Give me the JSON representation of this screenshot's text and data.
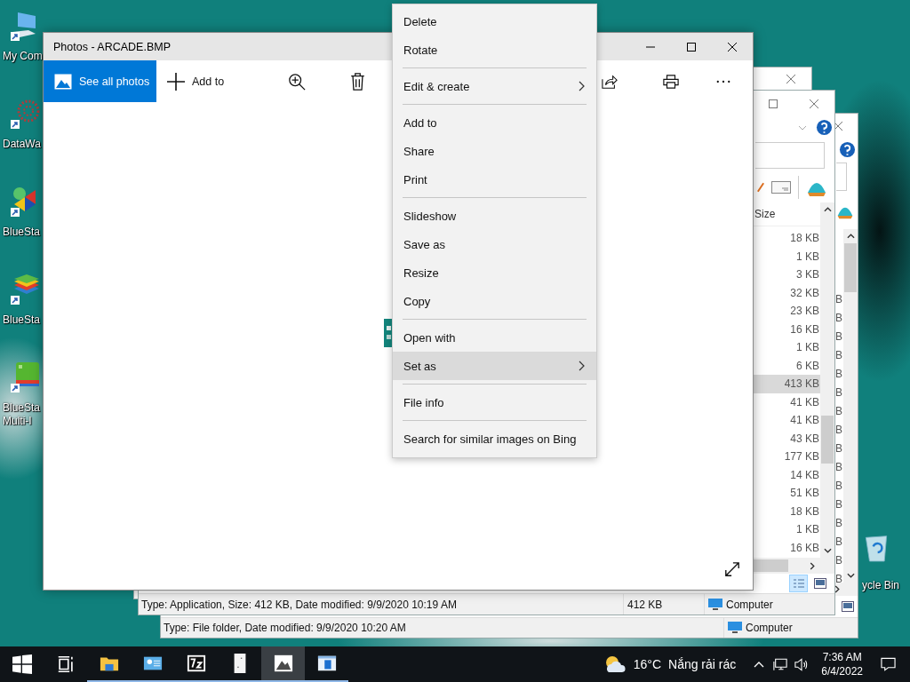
{
  "desktop": {
    "icons": [
      {
        "kind": "computer",
        "lines": [
          "My Com"
        ]
      },
      {
        "kind": "datawag",
        "lines": [
          "DataWa"
        ]
      },
      {
        "kind": "bluestacks-x",
        "lines": [
          "BlueSta"
        ]
      },
      {
        "kind": "bluestacks",
        "lines": [
          "BlueSta"
        ]
      },
      {
        "kind": "multi",
        "lines": [
          "BlueSta",
          "Multi-I"
        ]
      }
    ],
    "recycle_bin": {
      "label": "ycle Bin"
    }
  },
  "explorer_back": {
    "rows": [
      "B",
      "B",
      "B",
      "B",
      "B",
      "B",
      "B",
      "B",
      "B",
      "B",
      "B",
      "B",
      "B",
      "B",
      "B",
      "B"
    ],
    "status": {
      "info": "Type: File folder, Date modified: 9/9/2020 10:20 AM",
      "location": "Computer"
    }
  },
  "explorer_middle": {
    "size_header": "Size",
    "rows": [
      {
        "size": "18 KB",
        "selected": false
      },
      {
        "size": "1 KB",
        "selected": false
      },
      {
        "size": "3 KB",
        "selected": false
      },
      {
        "size": "32 KB",
        "selected": false
      },
      {
        "size": "23 KB",
        "selected": false
      },
      {
        "size": "16 KB",
        "selected": false
      },
      {
        "size": "1 KB",
        "selected": false
      },
      {
        "size": "6 KB",
        "selected": false
      },
      {
        "size": "413 KB",
        "selected": true
      },
      {
        "size": "41 KB",
        "selected": false
      },
      {
        "size": "41 KB",
        "selected": false
      },
      {
        "size": "43 KB",
        "selected": false
      },
      {
        "size": "177 KB",
        "selected": false
      },
      {
        "size": "14 KB",
        "selected": false
      },
      {
        "size": "51 KB",
        "selected": false
      },
      {
        "size": "18 KB",
        "selected": false
      },
      {
        "size": "1 KB",
        "selected": false
      },
      {
        "size": "16 KB",
        "selected": false
      }
    ],
    "status": {
      "info": "Type: Application, Size: 412 KB, Date modified: 9/9/2020 10:19 AM",
      "size": "412 KB",
      "location": "Computer"
    }
  },
  "photos": {
    "title": "Photos - ARCADE.BMP",
    "see_all": "See all photos",
    "add_to": "Add to"
  },
  "context_menu": {
    "groups": [
      [
        {
          "label": "Delete",
          "submenu": false,
          "selected": false
        },
        {
          "label": "Rotate",
          "submenu": false,
          "selected": false
        }
      ],
      [
        {
          "label": "Edit & create",
          "submenu": true,
          "selected": false
        }
      ],
      [
        {
          "label": "Add to",
          "submenu": false,
          "selected": false
        },
        {
          "label": "Share",
          "submenu": false,
          "selected": false
        },
        {
          "label": "Print",
          "submenu": false,
          "selected": false
        }
      ],
      [
        {
          "label": "Slideshow",
          "submenu": false,
          "selected": false
        },
        {
          "label": "Save as",
          "submenu": false,
          "selected": false
        },
        {
          "label": "Resize",
          "submenu": false,
          "selected": false
        },
        {
          "label": "Copy",
          "submenu": false,
          "selected": false
        }
      ],
      [
        {
          "label": "Open with",
          "submenu": false,
          "selected": false
        },
        {
          "label": "Set as",
          "submenu": true,
          "selected": true
        }
      ],
      [
        {
          "label": "File info",
          "submenu": false,
          "selected": false
        }
      ],
      [
        {
          "label": "Search for similar images on Bing",
          "submenu": false,
          "selected": false
        }
      ]
    ]
  },
  "taskbar": {
    "apps": [
      {
        "kind": "explorer",
        "open": true,
        "active": false
      },
      {
        "kind": "blue-app",
        "open": true,
        "active": false
      },
      {
        "kind": "archive",
        "open": true,
        "active": false
      },
      {
        "kind": "document",
        "open": true,
        "active": false
      },
      {
        "kind": "photos",
        "open": true,
        "active": true
      },
      {
        "kind": "blue-window",
        "open": true,
        "active": false
      }
    ],
    "weather": {
      "temp": "16°C",
      "text": "Nắng rải rác"
    },
    "clock": {
      "time": "7:36 AM",
      "date": "6/4/2022"
    }
  }
}
